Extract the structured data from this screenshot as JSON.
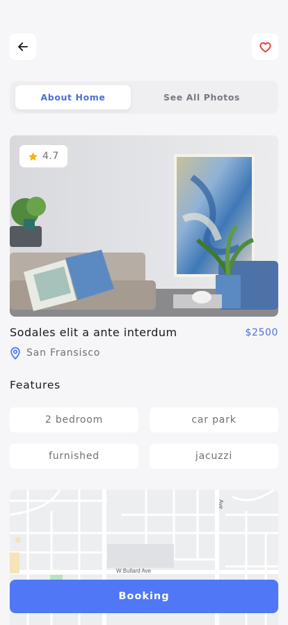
{
  "header": {
    "back_icon": "arrow-left-icon",
    "favorite_icon": "heart-outline-icon"
  },
  "tabs": [
    {
      "label": "About Home",
      "active": true
    },
    {
      "label": "See All Photos",
      "active": false
    }
  ],
  "listing": {
    "rating": "4.7",
    "rating_icon": "star-icon",
    "title": "Sodales elit a ante interdum",
    "price": "$2500",
    "location": "San Fransisco",
    "location_icon": "map-pin-icon"
  },
  "features": {
    "heading": "Features",
    "items": [
      "2 bedroom",
      "car park",
      "furnished",
      "jacuzzi"
    ]
  },
  "map": {
    "street_labels": [
      "W Bullard Ave",
      "Ave"
    ]
  },
  "booking": {
    "label": "Booking"
  },
  "colors": {
    "accent": "#4f77f6",
    "accent_text": "#4c6fd6",
    "heart": "#e53935",
    "star": "#f5b400",
    "background": "#f6f6f8"
  }
}
